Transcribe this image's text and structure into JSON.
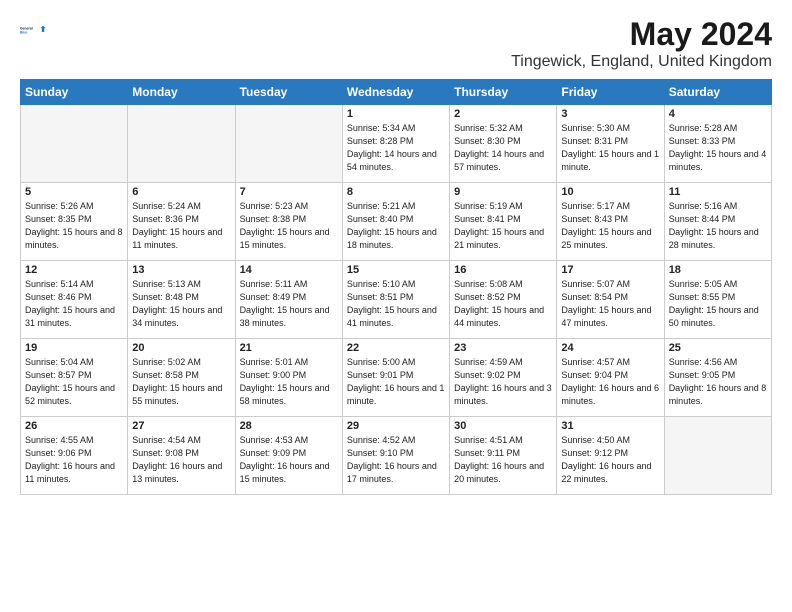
{
  "header": {
    "logo_line1": "General",
    "logo_line2": "Blue",
    "main_title": "May 2024",
    "subtitle": "Tingewick, England, United Kingdom"
  },
  "days_of_week": [
    "Sunday",
    "Monday",
    "Tuesday",
    "Wednesday",
    "Thursday",
    "Friday",
    "Saturday"
  ],
  "weeks": [
    [
      {
        "day": "",
        "empty": true
      },
      {
        "day": "",
        "empty": true
      },
      {
        "day": "",
        "empty": true
      },
      {
        "day": "1",
        "sunrise": "5:34 AM",
        "sunset": "8:28 PM",
        "daylight": "14 hours and 54 minutes."
      },
      {
        "day": "2",
        "sunrise": "5:32 AM",
        "sunset": "8:30 PM",
        "daylight": "14 hours and 57 minutes."
      },
      {
        "day": "3",
        "sunrise": "5:30 AM",
        "sunset": "8:31 PM",
        "daylight": "15 hours and 1 minute."
      },
      {
        "day": "4",
        "sunrise": "5:28 AM",
        "sunset": "8:33 PM",
        "daylight": "15 hours and 4 minutes."
      }
    ],
    [
      {
        "day": "5",
        "sunrise": "5:26 AM",
        "sunset": "8:35 PM",
        "daylight": "15 hours and 8 minutes."
      },
      {
        "day": "6",
        "sunrise": "5:24 AM",
        "sunset": "8:36 PM",
        "daylight": "15 hours and 11 minutes."
      },
      {
        "day": "7",
        "sunrise": "5:23 AM",
        "sunset": "8:38 PM",
        "daylight": "15 hours and 15 minutes."
      },
      {
        "day": "8",
        "sunrise": "5:21 AM",
        "sunset": "8:40 PM",
        "daylight": "15 hours and 18 minutes."
      },
      {
        "day": "9",
        "sunrise": "5:19 AM",
        "sunset": "8:41 PM",
        "daylight": "15 hours and 21 minutes."
      },
      {
        "day": "10",
        "sunrise": "5:17 AM",
        "sunset": "8:43 PM",
        "daylight": "15 hours and 25 minutes."
      },
      {
        "day": "11",
        "sunrise": "5:16 AM",
        "sunset": "8:44 PM",
        "daylight": "15 hours and 28 minutes."
      }
    ],
    [
      {
        "day": "12",
        "sunrise": "5:14 AM",
        "sunset": "8:46 PM",
        "daylight": "15 hours and 31 minutes."
      },
      {
        "day": "13",
        "sunrise": "5:13 AM",
        "sunset": "8:48 PM",
        "daylight": "15 hours and 34 minutes."
      },
      {
        "day": "14",
        "sunrise": "5:11 AM",
        "sunset": "8:49 PM",
        "daylight": "15 hours and 38 minutes."
      },
      {
        "day": "15",
        "sunrise": "5:10 AM",
        "sunset": "8:51 PM",
        "daylight": "15 hours and 41 minutes."
      },
      {
        "day": "16",
        "sunrise": "5:08 AM",
        "sunset": "8:52 PM",
        "daylight": "15 hours and 44 minutes."
      },
      {
        "day": "17",
        "sunrise": "5:07 AM",
        "sunset": "8:54 PM",
        "daylight": "15 hours and 47 minutes."
      },
      {
        "day": "18",
        "sunrise": "5:05 AM",
        "sunset": "8:55 PM",
        "daylight": "15 hours and 50 minutes."
      }
    ],
    [
      {
        "day": "19",
        "sunrise": "5:04 AM",
        "sunset": "8:57 PM",
        "daylight": "15 hours and 52 minutes."
      },
      {
        "day": "20",
        "sunrise": "5:02 AM",
        "sunset": "8:58 PM",
        "daylight": "15 hours and 55 minutes."
      },
      {
        "day": "21",
        "sunrise": "5:01 AM",
        "sunset": "9:00 PM",
        "daylight": "15 hours and 58 minutes."
      },
      {
        "day": "22",
        "sunrise": "5:00 AM",
        "sunset": "9:01 PM",
        "daylight": "16 hours and 1 minute."
      },
      {
        "day": "23",
        "sunrise": "4:59 AM",
        "sunset": "9:02 PM",
        "daylight": "16 hours and 3 minutes."
      },
      {
        "day": "24",
        "sunrise": "4:57 AM",
        "sunset": "9:04 PM",
        "daylight": "16 hours and 6 minutes."
      },
      {
        "day": "25",
        "sunrise": "4:56 AM",
        "sunset": "9:05 PM",
        "daylight": "16 hours and 8 minutes."
      }
    ],
    [
      {
        "day": "26",
        "sunrise": "4:55 AM",
        "sunset": "9:06 PM",
        "daylight": "16 hours and 11 minutes."
      },
      {
        "day": "27",
        "sunrise": "4:54 AM",
        "sunset": "9:08 PM",
        "daylight": "16 hours and 13 minutes."
      },
      {
        "day": "28",
        "sunrise": "4:53 AM",
        "sunset": "9:09 PM",
        "daylight": "16 hours and 15 minutes."
      },
      {
        "day": "29",
        "sunrise": "4:52 AM",
        "sunset": "9:10 PM",
        "daylight": "16 hours and 17 minutes."
      },
      {
        "day": "30",
        "sunrise": "4:51 AM",
        "sunset": "9:11 PM",
        "daylight": "16 hours and 20 minutes."
      },
      {
        "day": "31",
        "sunrise": "4:50 AM",
        "sunset": "9:12 PM",
        "daylight": "16 hours and 22 minutes."
      },
      {
        "day": "",
        "empty": true
      }
    ]
  ],
  "labels": {
    "sunrise_label": "Sunrise: ",
    "sunset_label": "Sunset: ",
    "daylight_label": "Daylight: "
  }
}
